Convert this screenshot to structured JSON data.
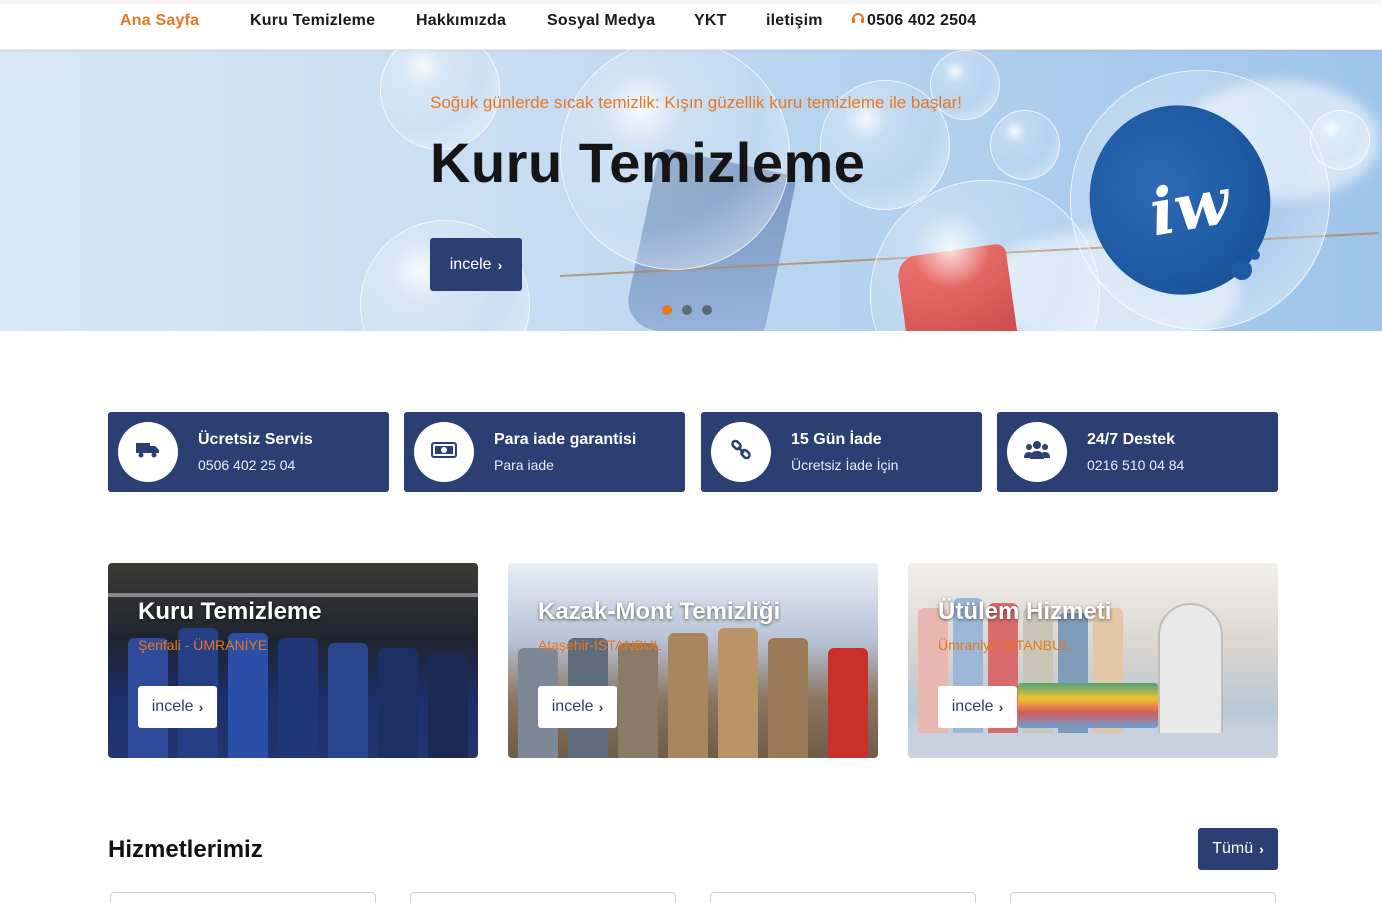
{
  "nav": {
    "items": [
      {
        "label": "Ana Sayfa",
        "active": true
      },
      {
        "label": "Kuru Temizleme",
        "active": false
      },
      {
        "label": "Hakkımızda",
        "active": false
      },
      {
        "label": "Sosyal Medya",
        "active": false
      },
      {
        "label": "YKT",
        "active": false
      },
      {
        "label": "iletişim",
        "active": false
      }
    ],
    "phone": "0506 402 2504",
    "phone_icon": "headset-icon"
  },
  "hero": {
    "kicker": "Soğuk günlerde sıcak temizlik: Kışın güzellik kuru temizleme ile başlar!",
    "headline": "Kuru Temizleme",
    "button_label": "incele",
    "slides": 3,
    "active_slide": 1
  },
  "features": [
    {
      "icon": "truck-icon",
      "title": "Ücretsiz Servis",
      "subtitle": "0506 402 25 04"
    },
    {
      "icon": "money-icon",
      "title": "Para iade garantisi",
      "subtitle": "Para iade"
    },
    {
      "icon": "link-icon",
      "title": "15 Gün İade",
      "subtitle": "Ücretsiz İade İçin"
    },
    {
      "icon": "users-icon",
      "title": "24/7 Destek",
      "subtitle": "0216 510 04 84"
    }
  ],
  "promos": [
    {
      "title": "Kuru Temizleme",
      "subtitle": "Şerifali - ÜMRANİYE",
      "button_label": "incele"
    },
    {
      "title": "Kazak-Mont Temizliği",
      "subtitle": "Ataşehir-İSTANBUL",
      "button_label": "incele"
    },
    {
      "title": "Ütülem Hizmeti",
      "subtitle": "Ümraniye-İSTANBUL",
      "button_label": "incele"
    }
  ],
  "services": {
    "title": "Hizmetlerimiz",
    "all_button": "Tümü"
  },
  "colors": {
    "accent": "#e87722",
    "primary": "#2b3f73"
  }
}
